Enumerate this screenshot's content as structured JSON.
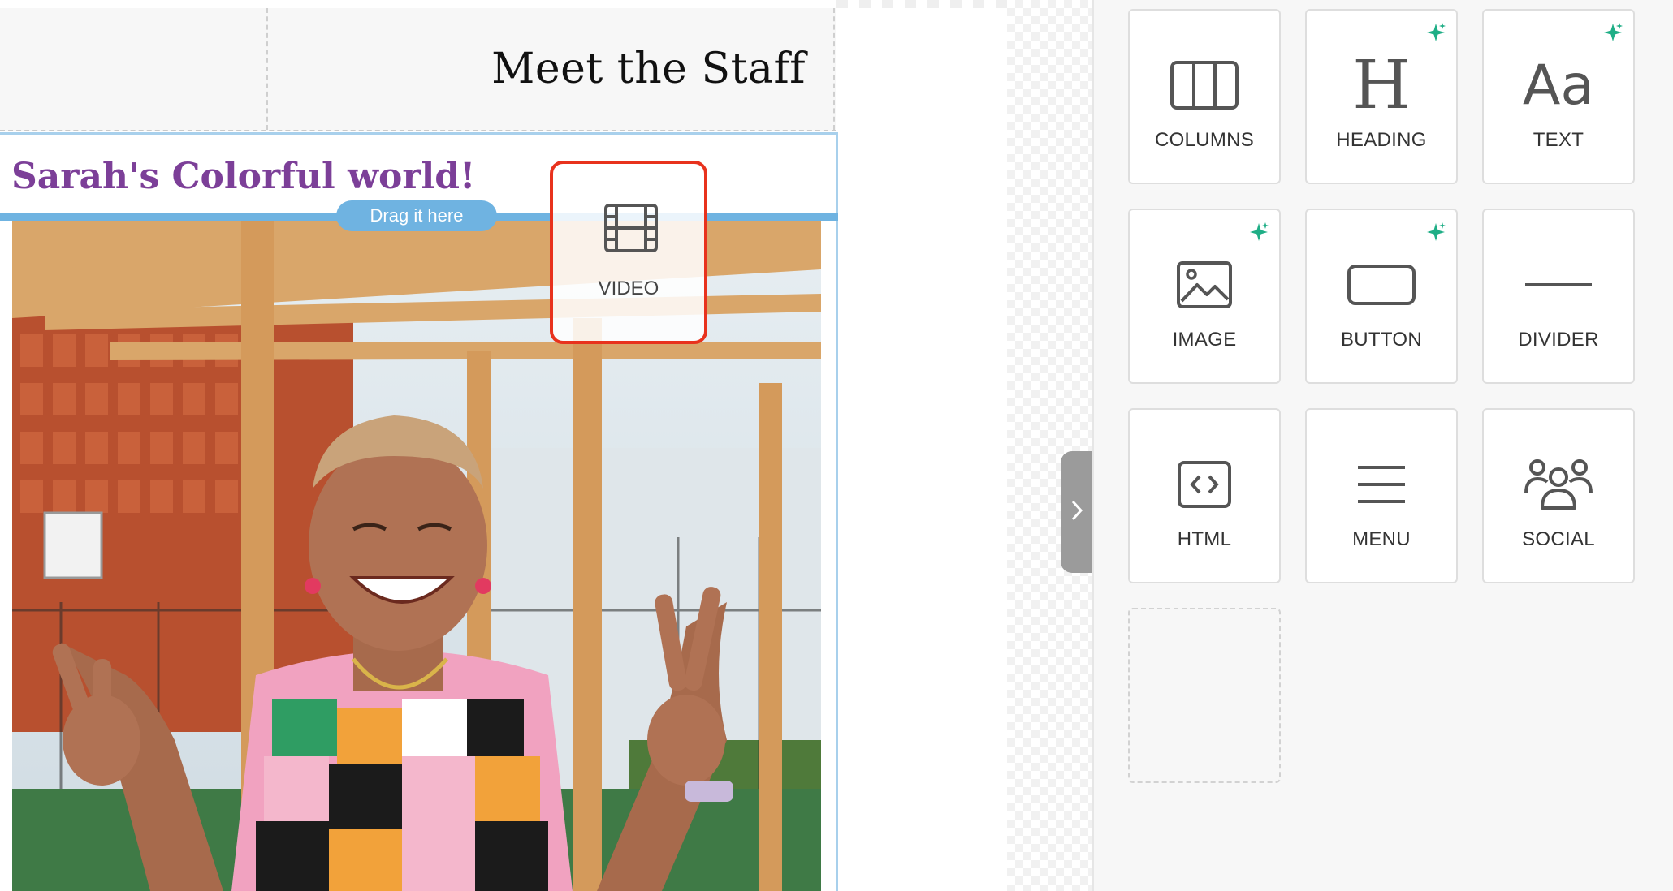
{
  "canvas": {
    "header_title": "Meet the Staff",
    "content_heading": "Sarah's Colorful world!",
    "drop_hint": "Drag it here",
    "dragged_block": {
      "label": "VIDEO",
      "icon": "film-icon"
    }
  },
  "panel": {
    "blocks": [
      {
        "label": "COLUMNS",
        "icon": "columns-icon",
        "ai": false
      },
      {
        "label": "HEADING",
        "icon": "heading-icon",
        "ai": true
      },
      {
        "label": "TEXT",
        "icon": "text-icon",
        "ai": true
      },
      {
        "label": "IMAGE",
        "icon": "image-icon",
        "ai": true
      },
      {
        "label": "BUTTON",
        "icon": "button-icon",
        "ai": true
      },
      {
        "label": "DIVIDER",
        "icon": "divider-icon",
        "ai": false
      },
      {
        "label": "HTML",
        "icon": "html-code-icon",
        "ai": false
      },
      {
        "label": "MENU",
        "icon": "menu-icon",
        "ai": false
      },
      {
        "label": "SOCIAL",
        "icon": "social-icon",
        "ai": false
      }
    ],
    "text_icon_glyph": "Aa",
    "heading_icon_glyph": "H"
  },
  "colors": {
    "heading_purple": "#7c3f98",
    "drop_blue": "#6fb3e1",
    "drag_border_red": "#e8321d",
    "ai_sparkle_green": "#1fae86"
  }
}
